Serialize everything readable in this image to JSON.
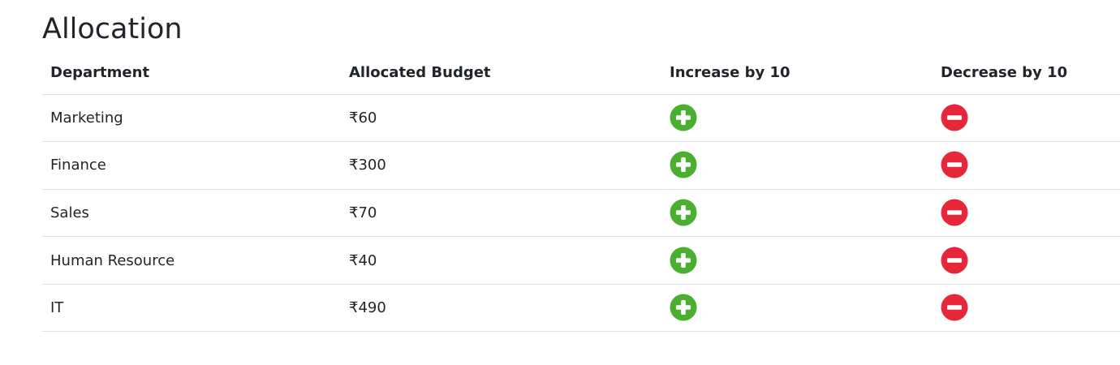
{
  "title": "Allocation",
  "table": {
    "headers": [
      "Department",
      "Allocated Budget",
      "Increase by 10",
      "Decrease by 10"
    ],
    "rows": [
      {
        "department": "Marketing",
        "budget": "₹60"
      },
      {
        "department": "Finance",
        "budget": "₹300"
      },
      {
        "department": "Sales",
        "budget": "₹70"
      },
      {
        "department": "Human Resource",
        "budget": "₹40"
      },
      {
        "department": "IT",
        "budget": "₹490"
      }
    ],
    "increase_icon": "plus-circle-icon",
    "decrease_icon": "minus-circle-icon"
  },
  "colors": {
    "increase": "#4aae2f",
    "decrease": "#e7263a"
  }
}
